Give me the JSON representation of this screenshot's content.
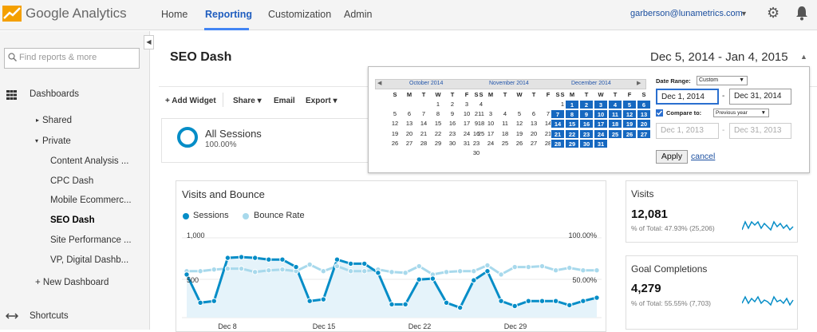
{
  "colors": {
    "accent": "#4285f4",
    "series_sessions": "#058dc7",
    "series_bounce": "#a8d9ec",
    "selected_day": "#1668c0"
  },
  "header": {
    "brand": "Google Analytics",
    "tabs": [
      {
        "label": "Home"
      },
      {
        "label": "Reporting",
        "active": true
      },
      {
        "label": "Customization"
      },
      {
        "label": "Admin"
      }
    ],
    "account_email": "garberson@lunametrics.com"
  },
  "sidebar": {
    "search_placeholder": "Find reports & more",
    "dashboards_label": "Dashboards",
    "shared_label": "Shared",
    "private_label": "Private",
    "dashboards": [
      {
        "label": "Content Analysis ..."
      },
      {
        "label": "CPC Dash"
      },
      {
        "label": "Mobile Ecommerc..."
      },
      {
        "label": "SEO Dash",
        "selected": true
      },
      {
        "label": "Site Performance ..."
      },
      {
        "label": "VP, Digital Dashb..."
      }
    ],
    "new_dashboard": "+ New Dashboard",
    "shortcuts_label": "Shortcuts"
  },
  "main": {
    "title": "SEO Dash",
    "date_range": "Dec 5, 2014 - Jan 4, 2015",
    "toolbar": {
      "add_widget": "+ Add Widget",
      "share": "Share",
      "email": "Email",
      "export": "Export"
    },
    "all_sessions": {
      "label": "All Sessions",
      "pct": "100.00%"
    }
  },
  "chart": {
    "title": "Visits and Bounce",
    "legend": [
      "Sessions",
      "Bounce Rate"
    ],
    "y_left_top": "1,000",
    "y_left_mid": "500",
    "y_right_top": "100.00%",
    "y_right_mid": "50.00%",
    "x_ticks": [
      "Dec 8",
      "Dec 15",
      "Dec 22",
      "Dec 29"
    ]
  },
  "chart_data": {
    "type": "line",
    "title": "Visits and Bounce",
    "x": [
      "Dec 5",
      "Dec 6",
      "Dec 7",
      "Dec 8",
      "Dec 9",
      "Dec 10",
      "Dec 11",
      "Dec 12",
      "Dec 13",
      "Dec 14",
      "Dec 15",
      "Dec 16",
      "Dec 17",
      "Dec 18",
      "Dec 19",
      "Dec 20",
      "Dec 21",
      "Dec 22",
      "Dec 23",
      "Dec 24",
      "Dec 25",
      "Dec 26",
      "Dec 27",
      "Dec 28",
      "Dec 29",
      "Dec 30",
      "Dec 31",
      "Jan 1",
      "Jan 2",
      "Jan 3",
      "Jan 4"
    ],
    "y_left_lim": [
      0,
      1000
    ],
    "y_right_lim": [
      0,
      100
    ],
    "series": [
      {
        "name": "Sessions",
        "axis": "left",
        "values": [
          520,
          180,
          200,
          720,
          730,
          720,
          700,
          700,
          610,
          200,
          220,
          700,
          650,
          650,
          540,
          160,
          160,
          460,
          470,
          180,
          120,
          450,
          560,
          200,
          140,
          200,
          200,
          200,
          150,
          200,
          240
        ]
      },
      {
        "name": "Bounce Rate",
        "axis": "right",
        "values": [
          56,
          56,
          58,
          59,
          59,
          55,
          57,
          58,
          56,
          64,
          56,
          62,
          56,
          56,
          58,
          55,
          54,
          62,
          52,
          55,
          56,
          56,
          63,
          52,
          61,
          61,
          62,
          57,
          60,
          57,
          57
        ]
      }
    ]
  },
  "visits": {
    "title": "Visits",
    "value": "12,081",
    "sub": "% of Total: 47.93% (25,206)"
  },
  "goals": {
    "title": "Goal Completions",
    "value": "4,279",
    "sub": "% of Total: 55.55% (7,703)"
  },
  "picker": {
    "months": [
      "October 2014",
      "November 2014",
      "December 2014"
    ],
    "dow": [
      "S",
      "M",
      "T",
      "W",
      "T",
      "F",
      "S"
    ],
    "calendars": [
      {
        "lead": 3,
        "days": 31,
        "selected": []
      },
      {
        "lead": 6,
        "days": 30,
        "selected": []
      },
      {
        "lead": 1,
        "days": 31,
        "selected": "all"
      }
    ],
    "date_range_label": "Date Range:",
    "range_option": "Custom",
    "start": "Dec 1, 2014",
    "end": "Dec 31, 2014",
    "compare_label": "Compare to:",
    "compare_option": "Previous year",
    "compare_start": "Dec 1, 2013",
    "compare_end": "Dec 31, 2013",
    "apply": "Apply",
    "cancel": "cancel"
  }
}
